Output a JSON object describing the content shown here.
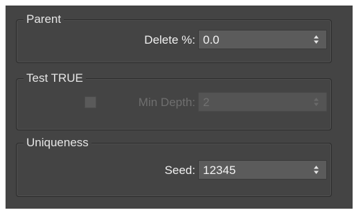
{
  "parent_group": {
    "title": "Parent",
    "delete_label": "Delete %:",
    "delete_value": "0.0"
  },
  "test_true_group": {
    "title": "Test TRUE",
    "min_depth_label": "Min Depth:",
    "min_depth_value": "2",
    "min_depth_checked": false,
    "enabled": false
  },
  "uniqueness_group": {
    "title": "Uniqueness",
    "seed_label": "Seed:",
    "seed_value": "12345"
  },
  "icons": {
    "spinner": "spinner-arrows-icon",
    "checkbox": "checkbox-icon"
  },
  "colors": {
    "panel_background": "#444444",
    "field_background": "#5b5b5b",
    "text": "#f0f0f0",
    "disabled_text": "#6f6f6f"
  }
}
